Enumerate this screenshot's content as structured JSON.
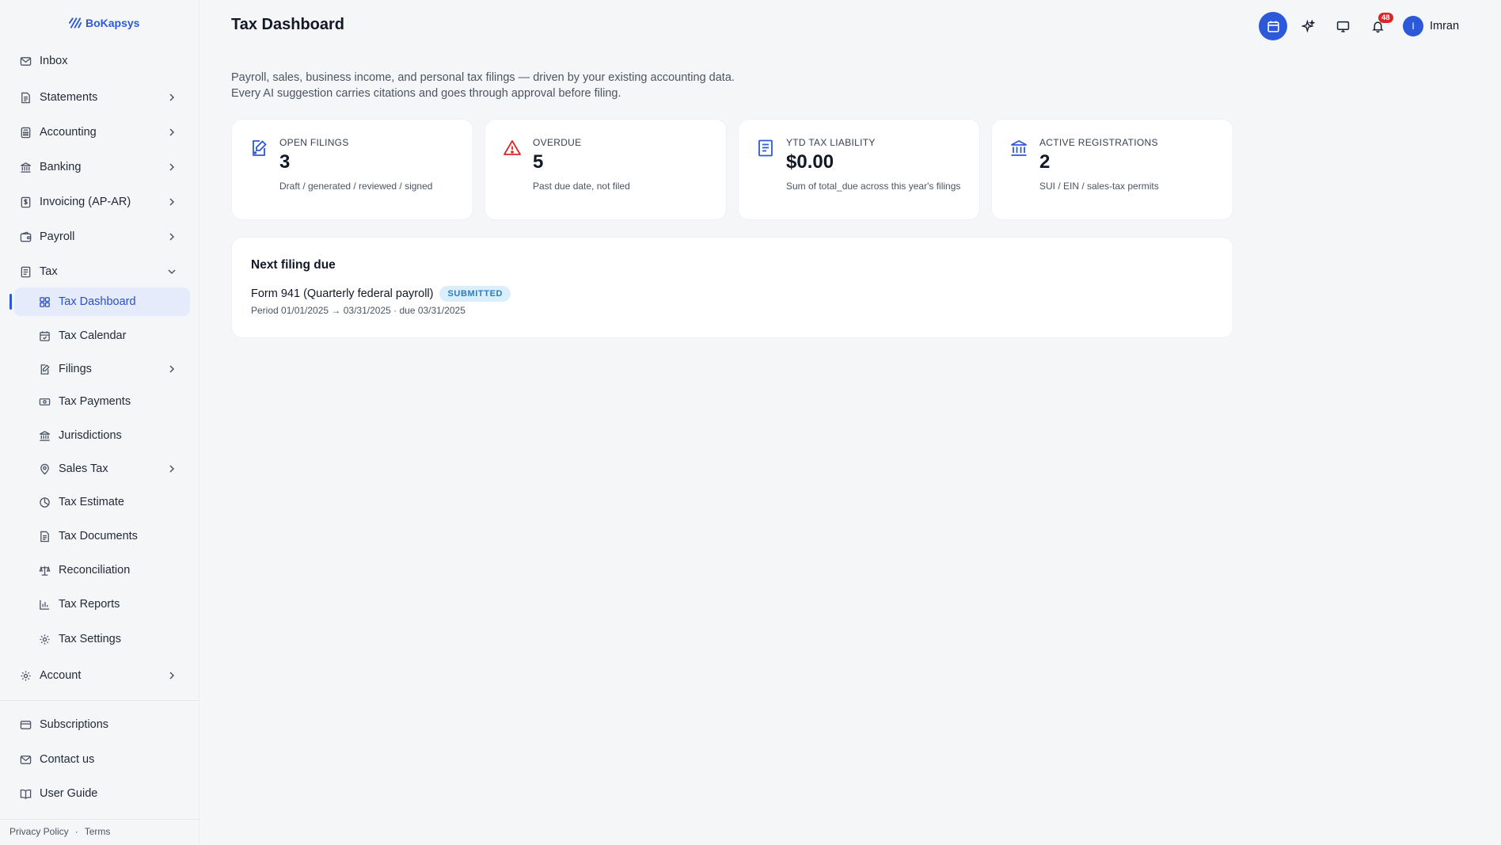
{
  "brand": {
    "name": "BoKapsys"
  },
  "sidebar": {
    "items": [
      {
        "label": "Inbox"
      },
      {
        "label": "Statements"
      },
      {
        "label": "Accounting"
      },
      {
        "label": "Banking"
      },
      {
        "label": "Invoicing (AP-AR)"
      },
      {
        "label": "Payroll"
      },
      {
        "label": "Tax"
      }
    ],
    "tax_sub": [
      {
        "label": "Tax Dashboard"
      },
      {
        "label": "Tax Calendar"
      },
      {
        "label": "Filings"
      },
      {
        "label": "Tax Payments"
      },
      {
        "label": "Jurisdictions"
      },
      {
        "label": "Sales Tax"
      },
      {
        "label": "Tax Estimate"
      },
      {
        "label": "Tax Documents"
      },
      {
        "label": "Reconciliation"
      },
      {
        "label": "Tax Reports"
      },
      {
        "label": "Tax Settings"
      }
    ],
    "account": {
      "label": "Account"
    },
    "bottom": [
      {
        "label": "Subscriptions"
      },
      {
        "label": "Contact us"
      },
      {
        "label": "User Guide"
      }
    ],
    "footer": {
      "privacy": "Privacy Policy",
      "sep": "·",
      "terms": "Terms"
    }
  },
  "header": {
    "title": "Tax Dashboard",
    "notifications_count": "48",
    "user_initial": "I",
    "user_name": "Imran"
  },
  "intro": {
    "line1": "Payroll, sales, business income, and personal tax filings — driven by your existing accounting data.",
    "line2": "Every AI suggestion carries citations and goes through approval before filing."
  },
  "cards": [
    {
      "title": "OPEN FILINGS",
      "value": "3",
      "sub": "Draft / generated / reviewed / signed",
      "icon": "edit-doc-icon"
    },
    {
      "title": "OVERDUE",
      "value": "5",
      "sub": "Past due date, not filed",
      "icon": "warning-icon"
    },
    {
      "title": "YTD TAX LIABILITY",
      "value": "$0.00",
      "sub": "Sum of total_due across this year's filings",
      "icon": "receipt-icon"
    },
    {
      "title": "ACTIVE REGISTRATIONS",
      "value": "2",
      "sub": "SUI / EIN / sales-tax permits",
      "icon": "bank-icon"
    }
  ],
  "next_filing": {
    "title": "Next filing due",
    "form": "Form 941 (Quarterly federal payroll)",
    "status": "SUBMITTED",
    "period": "Period 01/01/2025 → 03/31/2025 · due 03/31/2025"
  },
  "colors": {
    "accent": "#2b59d9",
    "danger": "#dc2626",
    "status_bg": "#dbeefb",
    "status_text": "#2b7dbf"
  }
}
